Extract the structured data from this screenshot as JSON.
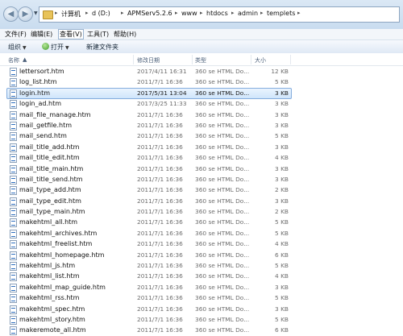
{
  "address": {
    "crumbs": [
      "计算机",
      "d (D:)",
      "APMServ5.2.6",
      "www",
      "htdocs",
      "admin",
      "templets"
    ]
  },
  "menu": [
    "文件(F)",
    "编辑(E)",
    "查看(V)",
    "工具(T)",
    "帮助(H)"
  ],
  "toolbar": {
    "organize_label": "组织",
    "open_label": "打开",
    "new_folder_label": "新建文件夹"
  },
  "columns": {
    "name": "名称",
    "modified": "修改日期",
    "type": "类型",
    "size": "大小"
  },
  "files": [
    {
      "name": "lettersort.htm",
      "date": "2017/4/11 16:31",
      "type": "360 se HTML Do...",
      "size": "12 KB"
    },
    {
      "name": "log_list.htm",
      "date": "2011/7/1 16:36",
      "type": "360 se HTML Do...",
      "size": "5 KB"
    },
    {
      "name": "login.htm",
      "date": "2017/5/31 13:04",
      "type": "360 se HTML Do...",
      "size": "3 KB"
    },
    {
      "name": "login_ad.htm",
      "date": "2017/3/25 11:33",
      "type": "360 se HTML Do...",
      "size": "3 KB"
    },
    {
      "name": "mail_file_manage.htm",
      "date": "2011/7/1 16:36",
      "type": "360 se HTML Do...",
      "size": "3 KB"
    },
    {
      "name": "mail_getfile.htm",
      "date": "2011/7/1 16:36",
      "type": "360 se HTML Do...",
      "size": "3 KB"
    },
    {
      "name": "mail_send.htm",
      "date": "2011/7/1 16:36",
      "type": "360 se HTML Do...",
      "size": "5 KB"
    },
    {
      "name": "mail_title_add.htm",
      "date": "2011/7/1 16:36",
      "type": "360 se HTML Do...",
      "size": "3 KB"
    },
    {
      "name": "mail_title_edit.htm",
      "date": "2011/7/1 16:36",
      "type": "360 se HTML Do...",
      "size": "4 KB"
    },
    {
      "name": "mail_title_main.htm",
      "date": "2011/7/1 16:36",
      "type": "360 se HTML Do...",
      "size": "3 KB"
    },
    {
      "name": "mail_title_send.htm",
      "date": "2011/7/1 16:36",
      "type": "360 se HTML Do...",
      "size": "3 KB"
    },
    {
      "name": "mail_type_add.htm",
      "date": "2011/7/1 16:36",
      "type": "360 se HTML Do...",
      "size": "2 KB"
    },
    {
      "name": "mail_type_edit.htm",
      "date": "2011/7/1 16:36",
      "type": "360 se HTML Do...",
      "size": "3 KB"
    },
    {
      "name": "mail_type_main.htm",
      "date": "2011/7/1 16:36",
      "type": "360 se HTML Do...",
      "size": "2 KB"
    },
    {
      "name": "makehtml_all.htm",
      "date": "2011/7/1 16:36",
      "type": "360 se HTML Do...",
      "size": "5 KB"
    },
    {
      "name": "makehtml_archives.htm",
      "date": "2011/7/1 16:36",
      "type": "360 se HTML Do...",
      "size": "5 KB"
    },
    {
      "name": "makehtml_freelist.htm",
      "date": "2011/7/1 16:36",
      "type": "360 se HTML Do...",
      "size": "4 KB"
    },
    {
      "name": "makehtml_homepage.htm",
      "date": "2011/7/1 16:36",
      "type": "360 se HTML Do...",
      "size": "6 KB"
    },
    {
      "name": "makehtml_js.htm",
      "date": "2011/7/1 16:36",
      "type": "360 se HTML Do...",
      "size": "5 KB"
    },
    {
      "name": "makehtml_list.htm",
      "date": "2011/7/1 16:36",
      "type": "360 se HTML Do...",
      "size": "4 KB"
    },
    {
      "name": "makehtml_map_guide.htm",
      "date": "2011/7/1 16:36",
      "type": "360 se HTML Do...",
      "size": "3 KB"
    },
    {
      "name": "makehtml_rss.htm",
      "date": "2011/7/1 16:36",
      "type": "360 se HTML Do...",
      "size": "5 KB"
    },
    {
      "name": "makehtml_spec.htm",
      "date": "2011/7/1 16:36",
      "type": "360 se HTML Do...",
      "size": "3 KB"
    },
    {
      "name": "makehtml_story.htm",
      "date": "2011/7/1 16:36",
      "type": "360 se HTML Do...",
      "size": "5 KB"
    },
    {
      "name": "makeremote_all.htm",
      "date": "2011/7/1 16:36",
      "type": "360 se HTML Do...",
      "size": "6 KB"
    }
  ],
  "selected_file": "login.htm",
  "icons": {
    "back": "back-arrow-icon",
    "forward": "forward-arrow-icon",
    "folder": "folder-icon",
    "file": "html-file-icon",
    "open": "open-green-icon"
  },
  "colors": {
    "selection": "#cfe5fb",
    "selection_border": "#84acdd",
    "chrome": "#dbe8f5"
  }
}
